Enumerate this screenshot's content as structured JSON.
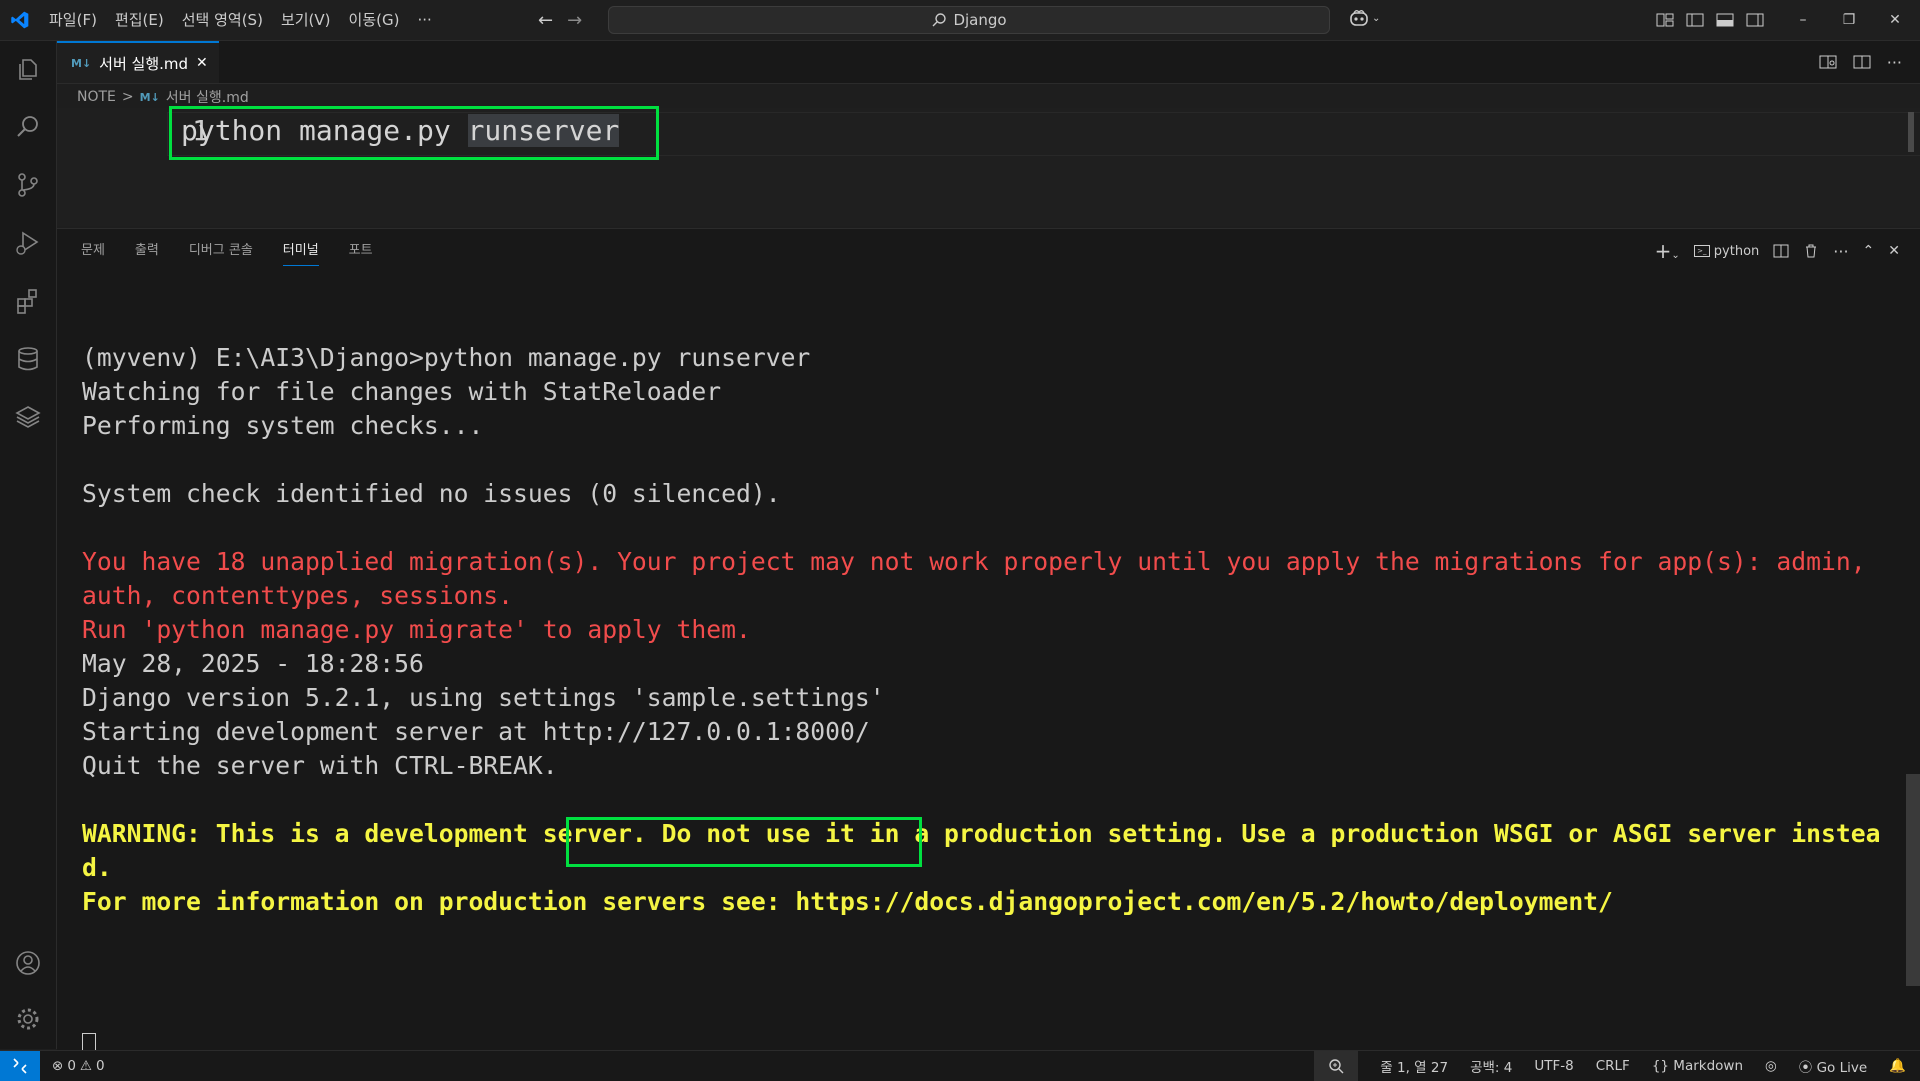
{
  "titlebar": {
    "menu": [
      "파일(F)",
      "편집(E)",
      "선택 영역(S)",
      "보기(V)",
      "이동(G)",
      "···"
    ],
    "search_text": "Django",
    "window_controls": [
      "–",
      "❐",
      "✕"
    ]
  },
  "activity_bar": {
    "items": [
      "explorer-icon",
      "search-icon",
      "source-control-icon",
      "run-debug-icon",
      "extensions-icon",
      "database-icon",
      "layers-icon"
    ],
    "bottom": [
      "account-icon",
      "settings-gear-icon"
    ]
  },
  "editor": {
    "tab": {
      "label": "서버 실행.md",
      "close": "✕",
      "icon": "M↓"
    },
    "breadcrumb": {
      "folder": "NOTE",
      "separator": ">",
      "file": "서버 실행.md"
    },
    "line_number": "1",
    "code": {
      "before": "python manage.py ",
      "selected": "runserver"
    }
  },
  "panel": {
    "tabs": [
      "문제",
      "출력",
      "디버그 콘솔",
      "터미널",
      "포트"
    ],
    "active_tab": "터미널",
    "terminal_name": "python",
    "add_label": "+",
    "lines": [
      {
        "text": "(myvenv) E:\\AI3\\Django>python manage.py runserver",
        "style": "norm"
      },
      {
        "text": "Watching for file changes with StatReloader",
        "style": "norm"
      },
      {
        "text": "Performing system checks...",
        "style": "norm"
      },
      {
        "text": "",
        "style": "norm"
      },
      {
        "text": "System check identified no issues (0 silenced).",
        "style": "norm"
      },
      {
        "text": "",
        "style": "norm"
      },
      {
        "text": "You have 18 unapplied migration(s). Your project may not work properly until you apply the migrations for app(s): admin,",
        "style": "red"
      },
      {
        "text": "auth, contenttypes, sessions.",
        "style": "red"
      },
      {
        "text": "Run 'python manage.py migrate' to apply them.",
        "style": "red"
      },
      {
        "text": "May 28, 2025 - 18:28:56",
        "style": "norm"
      },
      {
        "text": "Django version 5.2.1, using settings 'sample.settings'",
        "style": "norm"
      },
      {
        "text": "Starting development server at http://127.0.0.1:8000/",
        "style": "norm"
      },
      {
        "text": "Quit the server with CTRL-BREAK.",
        "style": "norm"
      },
      {
        "text": "",
        "style": "norm"
      },
      {
        "text": "WARNING: This is a development server. Do not use it in a production setting. Use a production WSGI or ASGI server instea",
        "style": "yellow"
      },
      {
        "text": "d.",
        "style": "yellow"
      },
      {
        "text": "For more information on production servers see: https://docs.djangoproject.com/en/5.2/howto/deployment/",
        "style": "yellow"
      }
    ]
  },
  "statusbar": {
    "errors": "0",
    "warnings": "0",
    "position": "줄 1, 열 27",
    "indent": "공백: 4",
    "encoding": "UTF-8",
    "eol": "CRLF",
    "language": "Markdown",
    "go_live": "Go Live"
  },
  "colors": {
    "highlight_box": "#00e040",
    "terminal_red": "#f14c4c",
    "terminal_yellow": "#f5f543",
    "accent": "#0078d4"
  }
}
